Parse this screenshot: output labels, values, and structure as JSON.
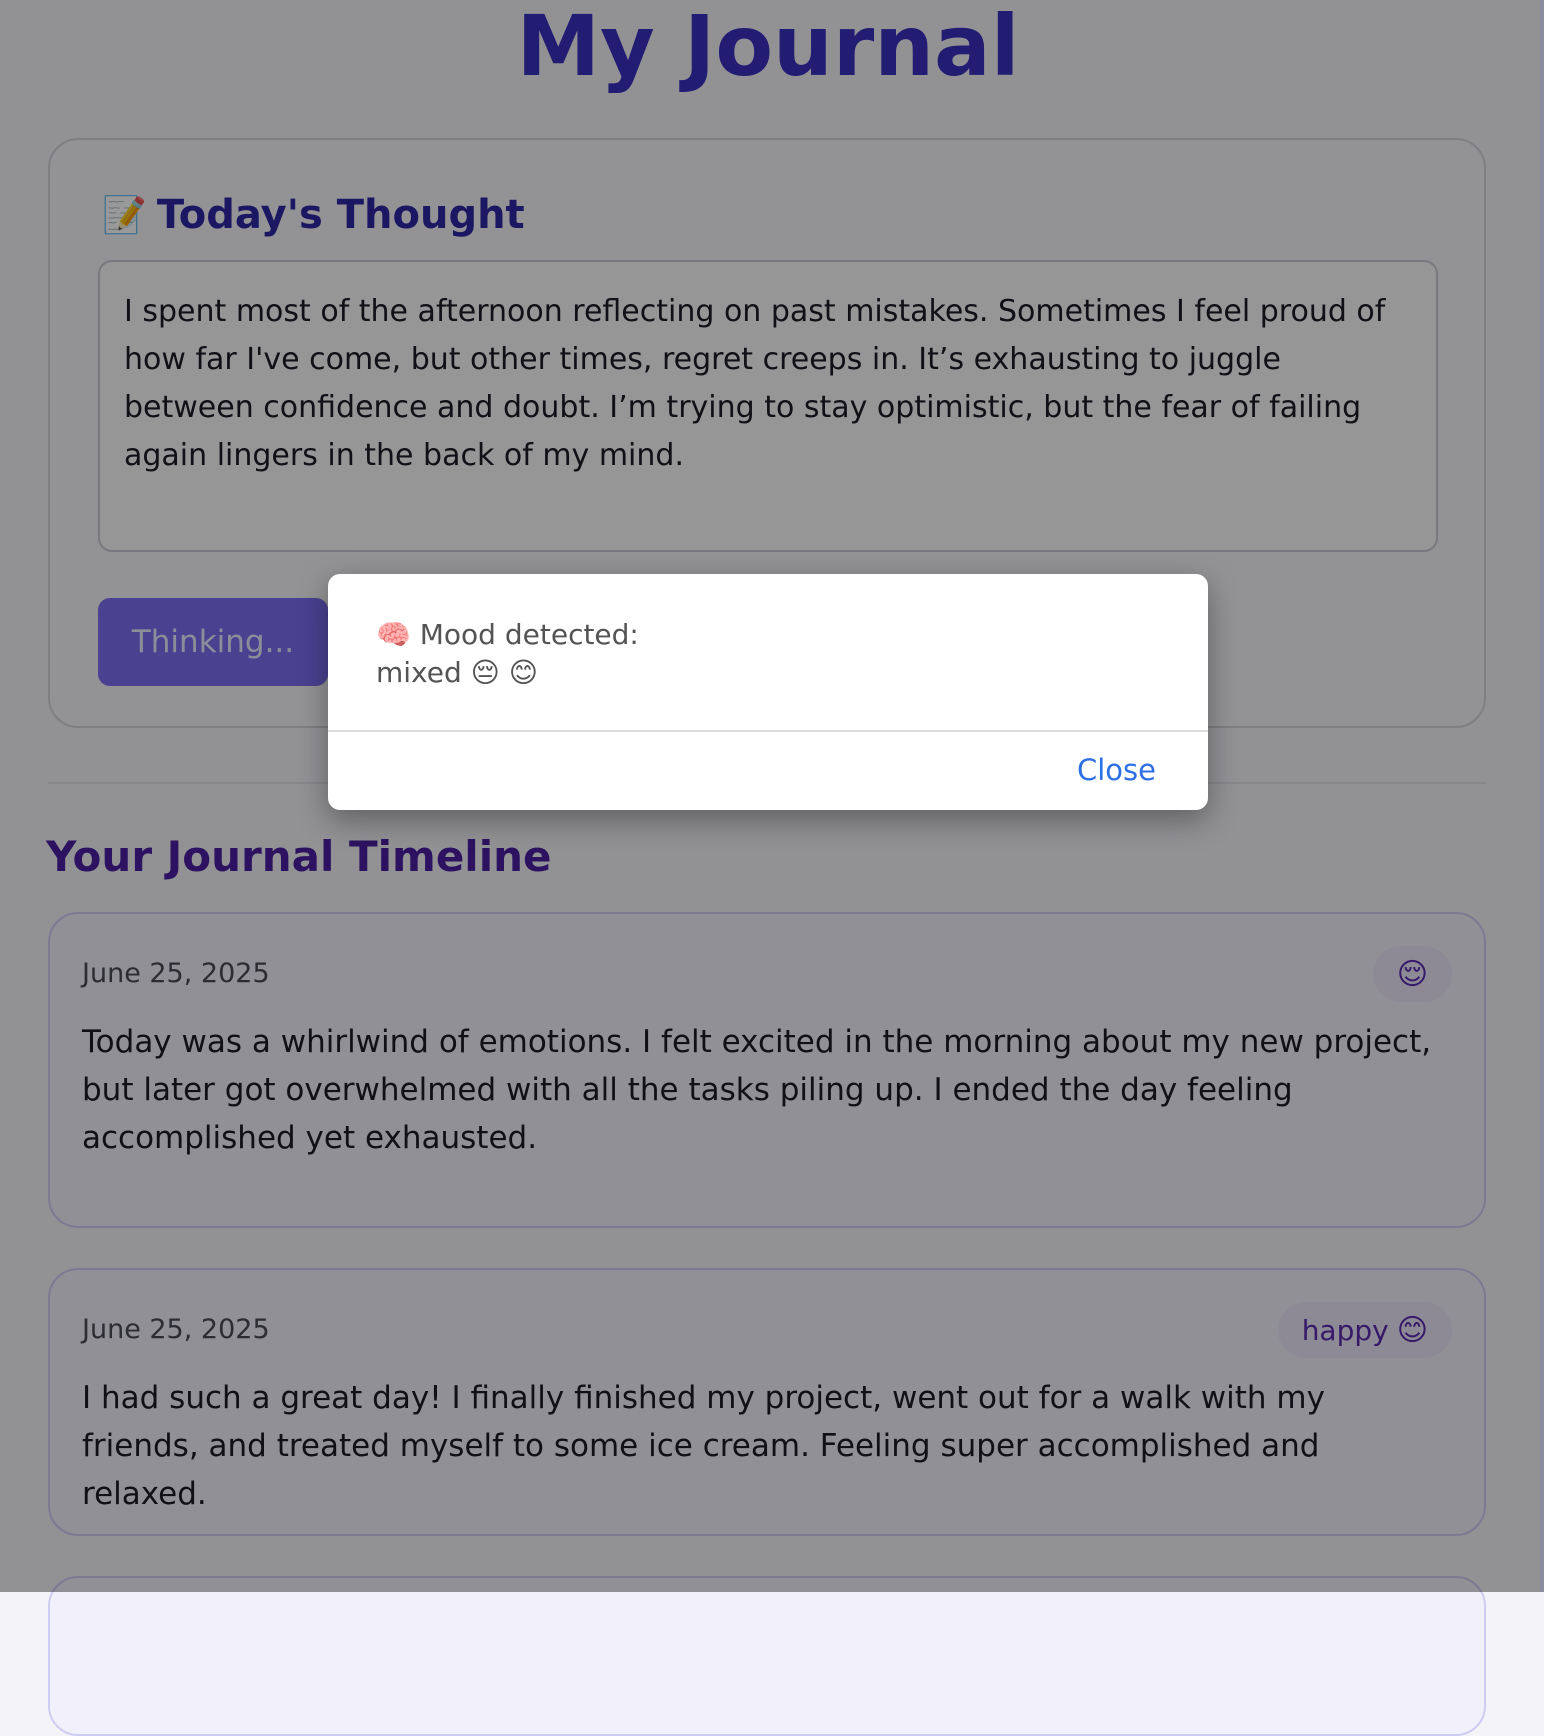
{
  "app": {
    "title": "My Journal"
  },
  "composer": {
    "icon": "memo-icon",
    "heading": "Today's Thought",
    "entry_text": "I spent most of the afternoon reflecting on past mistakes. Sometimes I feel proud of how far I've come, but other times, regret creeps in. It’s exhausting to juggle between confidence and doubt. I’m trying to stay optimistic, but the fear of failing again lingers in the back of my mind.",
    "submit_label": "Thinking..."
  },
  "timeline": {
    "heading": "Your Journal Timeline",
    "entries": [
      {
        "date": "June 25, 2025",
        "mood_label": "",
        "mood_emoji": "😌",
        "text": "Today was a whirlwind of emotions. I felt excited in the morning about my new project, but later got overwhelmed with all the tasks piling up. I ended the day feeling accomplished yet exhausted."
      },
      {
        "date": "June 25, 2025",
        "mood_label": "happy",
        "mood_emoji": "😊",
        "text": "I had such a great day! I finally finished my project, went out for a walk with my friends, and treated myself to some ice cream. Feeling super accomplished and relaxed."
      }
    ]
  },
  "modal": {
    "line1": "🧠 Mood detected:",
    "line2": "mixed 😔 😊",
    "close_label": "Close"
  },
  "colors": {
    "title": "#3a2fc0",
    "accent_button": "#7c6df0",
    "timeline_heading": "#4a1fa0",
    "modal_link": "#2f6fe4"
  }
}
